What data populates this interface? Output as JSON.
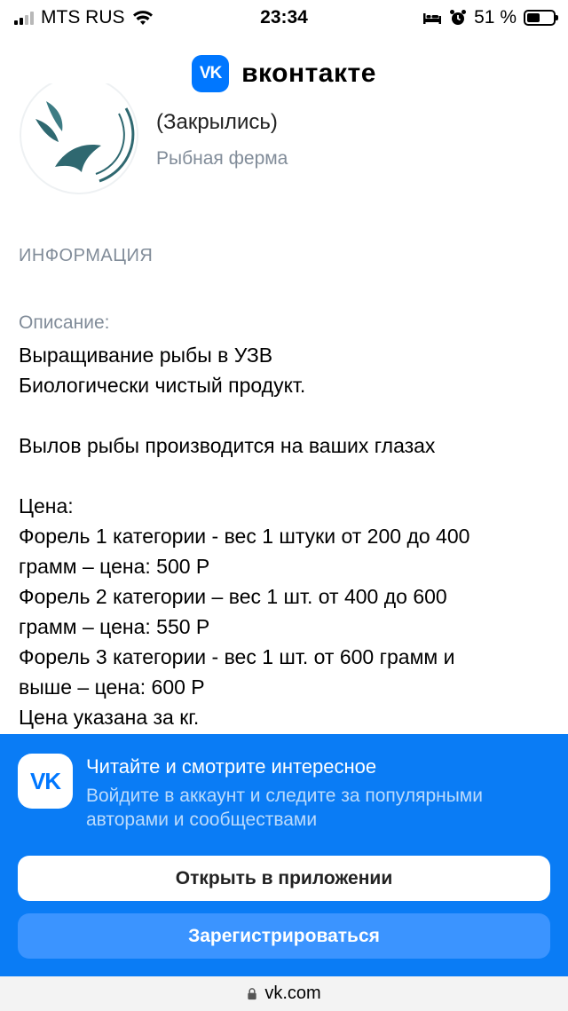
{
  "status_bar": {
    "carrier": "MTS RUS",
    "time": "23:34",
    "battery_percent": "51 %",
    "battery_level": 0.51
  },
  "header": {
    "logo_text": "VK",
    "brand": "вконтакте"
  },
  "community": {
    "name": "(Закрылись)",
    "type": "Рыбная ферма"
  },
  "info": {
    "section_title": "ИНФОРМАЦИЯ",
    "description_label": "Описание:",
    "lines": [
      "Выращивание рыбы в УЗВ",
      "Биологически чистый продукт.",
      "",
      "Вылов рыбы производится на ваших глазах",
      "",
      "Цена:",
      "Форель 1 категории - вес 1 штуки от 200 до 400",
      "грамм – цена: 500 Р",
      "Форель 2 категории – вес 1 шт. от 400 до 600",
      "грамм – цена: 550 Р",
      "Форель 3 категории - вес 1 шт. от 600 грамм и",
      "выше – цена: 600 Р",
      "Цена указана за кг."
    ]
  },
  "promo": {
    "icon_text": "VK",
    "title": "Читайте и смотрите интересное",
    "subtitle": "Войдите в аккаунт и следите за популярными авторами и сообществами",
    "open_app_label": "Открыть в приложении",
    "register_label": "Зарегистрироваться"
  },
  "address_bar": {
    "url": "vk.com"
  },
  "colors": {
    "accent": "#0077ff",
    "promo_bg": "#0a7cf5",
    "secondary_text": "#818c99"
  }
}
